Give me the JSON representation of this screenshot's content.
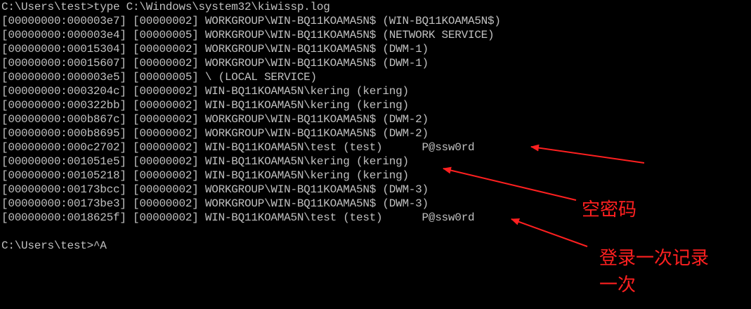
{
  "console": {
    "command_line": "C:\\Users\\test>type C:\\Windows\\system32\\kiwissp.log",
    "log_lines": [
      "[00000000:000003e7] [00000002] WORKGROUP\\WIN-BQ11KOAMA5N$ (WIN-BQ11KOAMA5N$)",
      "[00000000:000003e4] [00000005] WORKGROUP\\WIN-BQ11KOAMA5N$ (NETWORK SERVICE)",
      "[00000000:00015304] [00000002] WORKGROUP\\WIN-BQ11KOAMA5N$ (DWM-1)",
      "[00000000:00015607] [00000002] WORKGROUP\\WIN-BQ11KOAMA5N$ (DWM-1)",
      "[00000000:000003e5] [00000005] \\ (LOCAL SERVICE)",
      "[00000000:0003204c] [00000002] WIN-BQ11KOAMA5N\\kering (kering)",
      "[00000000:000322bb] [00000002] WIN-BQ11KOAMA5N\\kering (kering)",
      "[00000000:000b867c] [00000002] WORKGROUP\\WIN-BQ11KOAMA5N$ (DWM-2)",
      "[00000000:000b8695] [00000002] WORKGROUP\\WIN-BQ11KOAMA5N$ (DWM-2)",
      "[00000000:000c2702] [00000002] WIN-BQ11KOAMA5N\\test (test)      P@ssw0rd",
      "[00000000:001051e5] [00000002] WIN-BQ11KOAMA5N\\kering (kering)",
      "[00000000:00105218] [00000002] WIN-BQ11KOAMA5N\\kering (kering)",
      "[00000000:00173bcc] [00000002] WORKGROUP\\WIN-BQ11KOAMA5N$ (DWM-3)",
      "[00000000:00173be3] [00000002] WORKGROUP\\WIN-BQ11KOAMA5N$ (DWM-3)",
      "[00000000:0018625f] [00000002] WIN-BQ11KOAMA5N\\test (test)      P@ssw0rd"
    ],
    "prompt_line": "C:\\Users\\test>^A"
  },
  "annotations": {
    "empty_password": "空密码",
    "login_note_line1": "登录一次记录",
    "login_note_line2": "一次",
    "arrow_color": "#ff2020"
  },
  "colors": {
    "background": "#000000",
    "console_text": "#c0c0c0"
  }
}
